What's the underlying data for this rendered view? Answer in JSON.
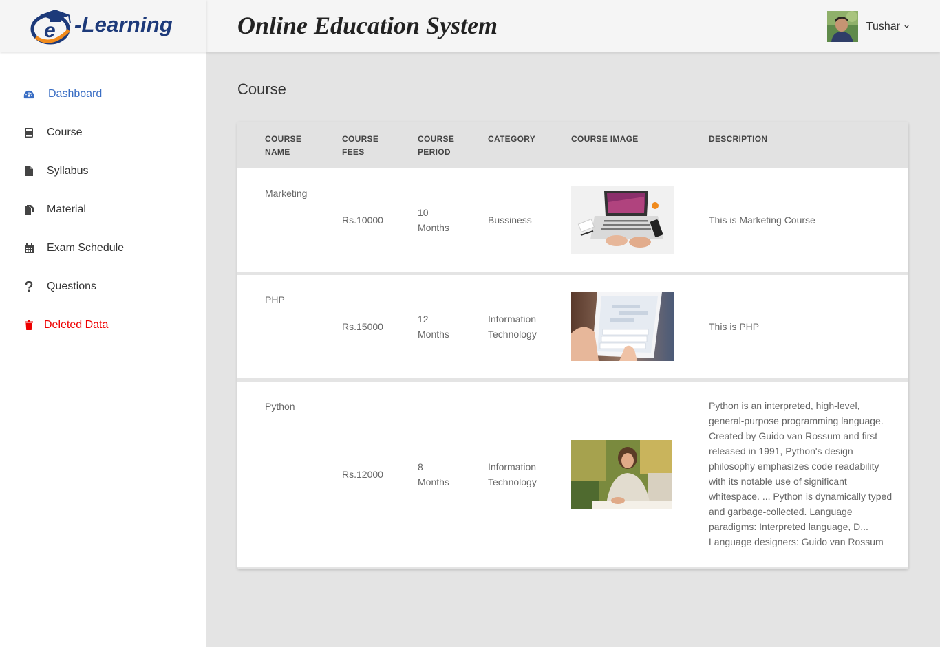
{
  "brand": {
    "logo_letter": "e",
    "logo_text": "-Learning"
  },
  "header": {
    "title": "Online Education System",
    "user_name": "Tushar"
  },
  "sidebar": {
    "items": [
      {
        "label": "Dashboard",
        "icon": "dashboard-icon",
        "active": true
      },
      {
        "label": "Course",
        "icon": "book-icon"
      },
      {
        "label": "Syllabus",
        "icon": "file-icon"
      },
      {
        "label": "Material",
        "icon": "files-icon"
      },
      {
        "label": "Exam Schedule",
        "icon": "calendar-icon"
      },
      {
        "label": "Questions",
        "icon": "question-icon"
      },
      {
        "label": "Deleted Data",
        "icon": "trash-icon",
        "danger": true
      }
    ]
  },
  "page": {
    "title": "Course"
  },
  "table": {
    "columns": [
      "COURSE\nNAME",
      "COURSE\nFEES",
      "COURSE\nPERIOD",
      "CATEGORY",
      "COURSE IMAGE",
      "DESCRIPTION"
    ],
    "rows": [
      {
        "name": "Marketing",
        "fees": "Rs.10000",
        "period": "10\nMonths",
        "category": "Bussiness",
        "image": "laptop-desk-photo",
        "description": "This is Marketing Course"
      },
      {
        "name": "PHP",
        "fees": "Rs.15000",
        "period": "12\nMonths",
        "category": "Information\nTechnology",
        "image": "tablet-hands-photo",
        "description": "This is PHP"
      },
      {
        "name": "Python",
        "fees": "Rs.12000",
        "period": "8\nMonths",
        "category": "Information\nTechnology",
        "image": "woman-writing-photo",
        "description": "Python is an interpreted, high-level, general-purpose programming language. Created by Guido van Rossum and first released in 1991, Python's design philosophy emphasizes code readability with its notable use of significant whitespace. ... Python is dynamically typed and garbage-collected. Language paradigms: Interpreted language, D... Language designers: Guido van Rossum"
      }
    ]
  },
  "colors": {
    "accent": "#3a6ec4",
    "danger": "#e00000",
    "brand": "#1d3a7a",
    "logo_orange": "#f08a1c"
  }
}
